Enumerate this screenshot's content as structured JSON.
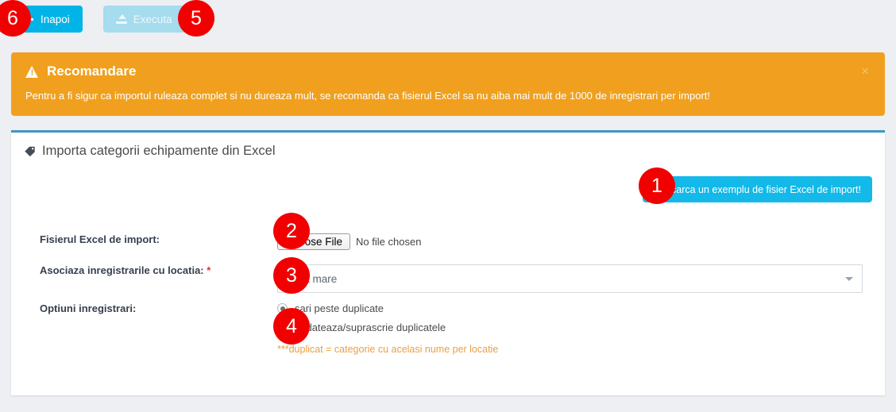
{
  "toolbar": {
    "back_label": "Inapoi",
    "back_icon": "arrow-left-icon",
    "execute_label": "Executa",
    "execute_icon": "upload-icon"
  },
  "badges": {
    "b1": "1",
    "b2": "2",
    "b3": "3",
    "b4": "4",
    "b5": "5",
    "b6": "6"
  },
  "alert": {
    "icon": "warning-triangle-icon",
    "title": "Recomandare",
    "text": "Pentru a fi sigur ca importul ruleaza complet si nu dureaza mult, se recomanda ca fisierul Excel sa nu aiba mai mult de 1000 de inregistrari per import!",
    "close_label": "×",
    "background_color": "#f0a01e"
  },
  "card": {
    "icon": "tag-icon",
    "title": "Importa categorii echipamente din Excel",
    "accent_color": "#3f96c4",
    "download_button": "Descarca un exemplu de fisier Excel de import!",
    "download_button_color": "#13b9e8"
  },
  "form": {
    "file_label": "Fisierul Excel de import:",
    "file_button": "Choose File",
    "file_status": "No file chosen",
    "location_label": "Asociaza inregistrarile cu locatia:",
    "location_required_mark": "*",
    "location_value": "Hala mare",
    "location_caret_icon": "chevron-down-icon",
    "options_label": "Optiuni inregistrari:",
    "options": [
      {
        "label": "sari peste duplicate",
        "checked": true
      },
      {
        "label": "updateaza/suprascrie duplicatele",
        "checked": false
      }
    ],
    "note": "***duplicat = categorie cu acelasi nume per locatie",
    "note_color": "#e8a043"
  }
}
